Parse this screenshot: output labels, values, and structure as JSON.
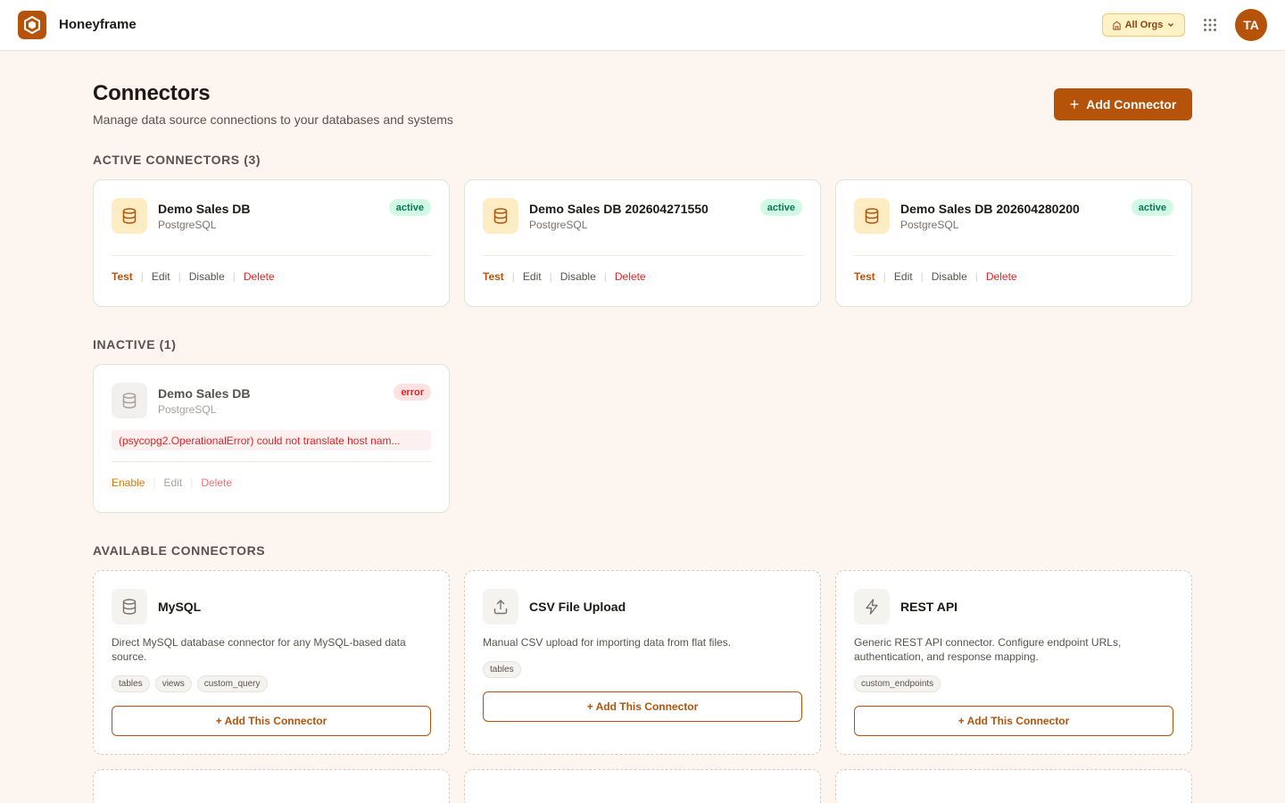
{
  "app": {
    "brand": "Honeyframe",
    "org_selector": "All Orgs",
    "avatar_initials": "TA",
    "accent": "#b45309"
  },
  "header": {
    "title": "Connectors",
    "subtitle": "Manage data source connections to your databases and systems",
    "add_button": "Add Connector"
  },
  "sections": {
    "active": "ACTIVE CONNECTORS (3)",
    "inactive": "INACTIVE (1)",
    "available": "AVAILABLE CONNECTORS"
  },
  "active": [
    {
      "name": "Demo Sales DB",
      "type": "PostgreSQL",
      "status": "active",
      "icon": "database-icon"
    },
    {
      "name": "Demo Sales DB 202604271550",
      "type": "PostgreSQL",
      "status": "active",
      "icon": "database-icon"
    },
    {
      "name": "Demo Sales DB 202604280200",
      "type": "PostgreSQL",
      "status": "active",
      "icon": "database-icon"
    }
  ],
  "active_actions": {
    "test": "Test",
    "edit": "Edit",
    "disable": "Disable",
    "delete": "Delete"
  },
  "inactive": [
    {
      "name": "Demo Sales DB",
      "type": "PostgreSQL",
      "status": "error",
      "error": "(psycopg2.OperationalError) could not translate host nam...",
      "icon": "database-icon"
    }
  ],
  "inactive_actions": {
    "enable": "Enable",
    "edit": "Edit",
    "delete": "Delete"
  },
  "available": [
    {
      "name": "MySQL",
      "icon": "database-icon",
      "description": "Direct MySQL database connector for any MySQL-based data source.",
      "tags": [
        "tables",
        "views",
        "custom_query"
      ]
    },
    {
      "name": "CSV File Upload",
      "icon": "upload-icon",
      "description": "Manual CSV upload for importing data from flat files.",
      "tags": [
        "tables"
      ]
    },
    {
      "name": "REST API",
      "icon": "lightning-icon",
      "description": "Generic REST API connector. Configure endpoint URLs, authentication, and response mapping.",
      "tags": [
        "custom_endpoints"
      ]
    }
  ],
  "add_this_label": "+ Add This Connector"
}
